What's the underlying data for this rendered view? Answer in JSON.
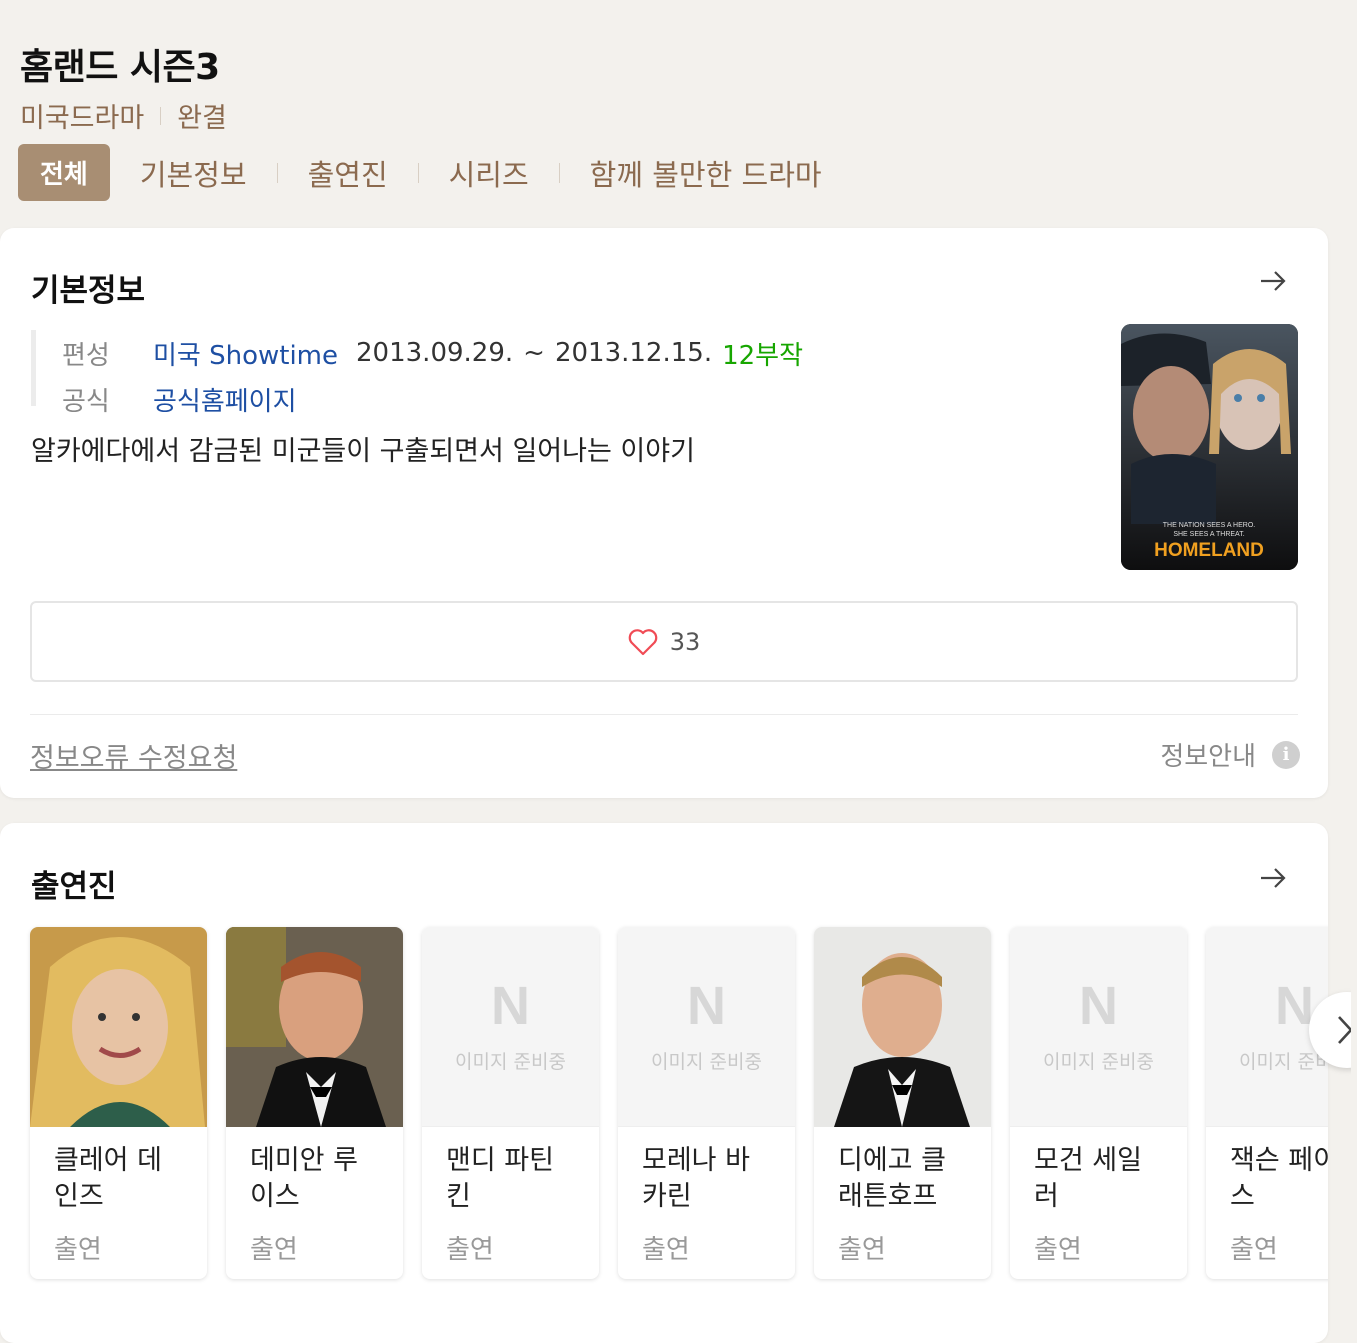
{
  "header": {
    "title": "홈랜드 시즌3",
    "genre": "미국드라마",
    "status": "완결",
    "tabs": [
      {
        "label": "전체",
        "active": true
      },
      {
        "label": "기본정보"
      },
      {
        "label": "출연진"
      },
      {
        "label": "시리즈"
      },
      {
        "label": "함께 볼만한 드라마"
      }
    ]
  },
  "basic_info": {
    "title": "기본정보",
    "broadcast_label": "편성",
    "broadcast_channel": "미국 Showtime",
    "date_start": "2013.09.29.",
    "date_sep": "~",
    "date_end": "2013.12.15.",
    "episodes": "12부작",
    "official_label": "공식",
    "official_link": "공식홈페이지",
    "summary": "알카에다에서 감금된 미군들이 구출되면서 일어나는 이야기",
    "poster": {
      "tagline_1": "THE NATION SEES A HERO.",
      "tagline_2": "SHE SEES A THREAT.",
      "logo": "HOMELAND"
    },
    "like_count": "33",
    "report_link": "정보오류 수정요청",
    "info_guide": "정보안내",
    "info_icon": "i"
  },
  "cast": {
    "title": "출연진",
    "placeholder_logo": "N",
    "placeholder_text": "이미지 준비중",
    "members": [
      {
        "name": "클레어 데인즈",
        "role": "출연"
      },
      {
        "name": "데미안 루이스",
        "role": "출연"
      },
      {
        "name": "맨디 파틴킨",
        "role": "출연"
      },
      {
        "name": "모레나 바카린",
        "role": "출연"
      },
      {
        "name": "디에고 클래튼호프",
        "role": "출연"
      },
      {
        "name": "모건 세일러",
        "role": "출연"
      },
      {
        "name": "잭슨 페이스",
        "role": "출연"
      }
    ]
  },
  "colors": {
    "accent": "#a88e73",
    "brown_text": "#8b6a4f",
    "link_blue": "#1e4fa3",
    "episodes_green": "#17a600",
    "heart": "#f04b55"
  }
}
